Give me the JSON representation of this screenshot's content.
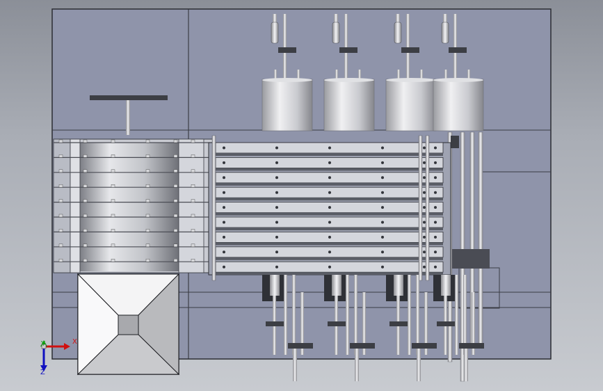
{
  "axes": {
    "x_label": "X",
    "y_label": "Y",
    "z_label": "Z"
  },
  "colors": {
    "frame_fill": "#8f94aa",
    "frame_line": "#2b2d33",
    "plate_fill": "#d4d6dc",
    "plate_dark": "#5a5d66",
    "tank_light": "#e8e8ea",
    "tank_dark": "#8c8d92",
    "bar_dark": "#3c3e44",
    "axis_x": "#d01010",
    "axis_y": "#10a010",
    "axis_z": "#1010c0"
  },
  "counts": {
    "plates": 9,
    "top_cylinders": 4,
    "bottom_pipes": 4
  }
}
